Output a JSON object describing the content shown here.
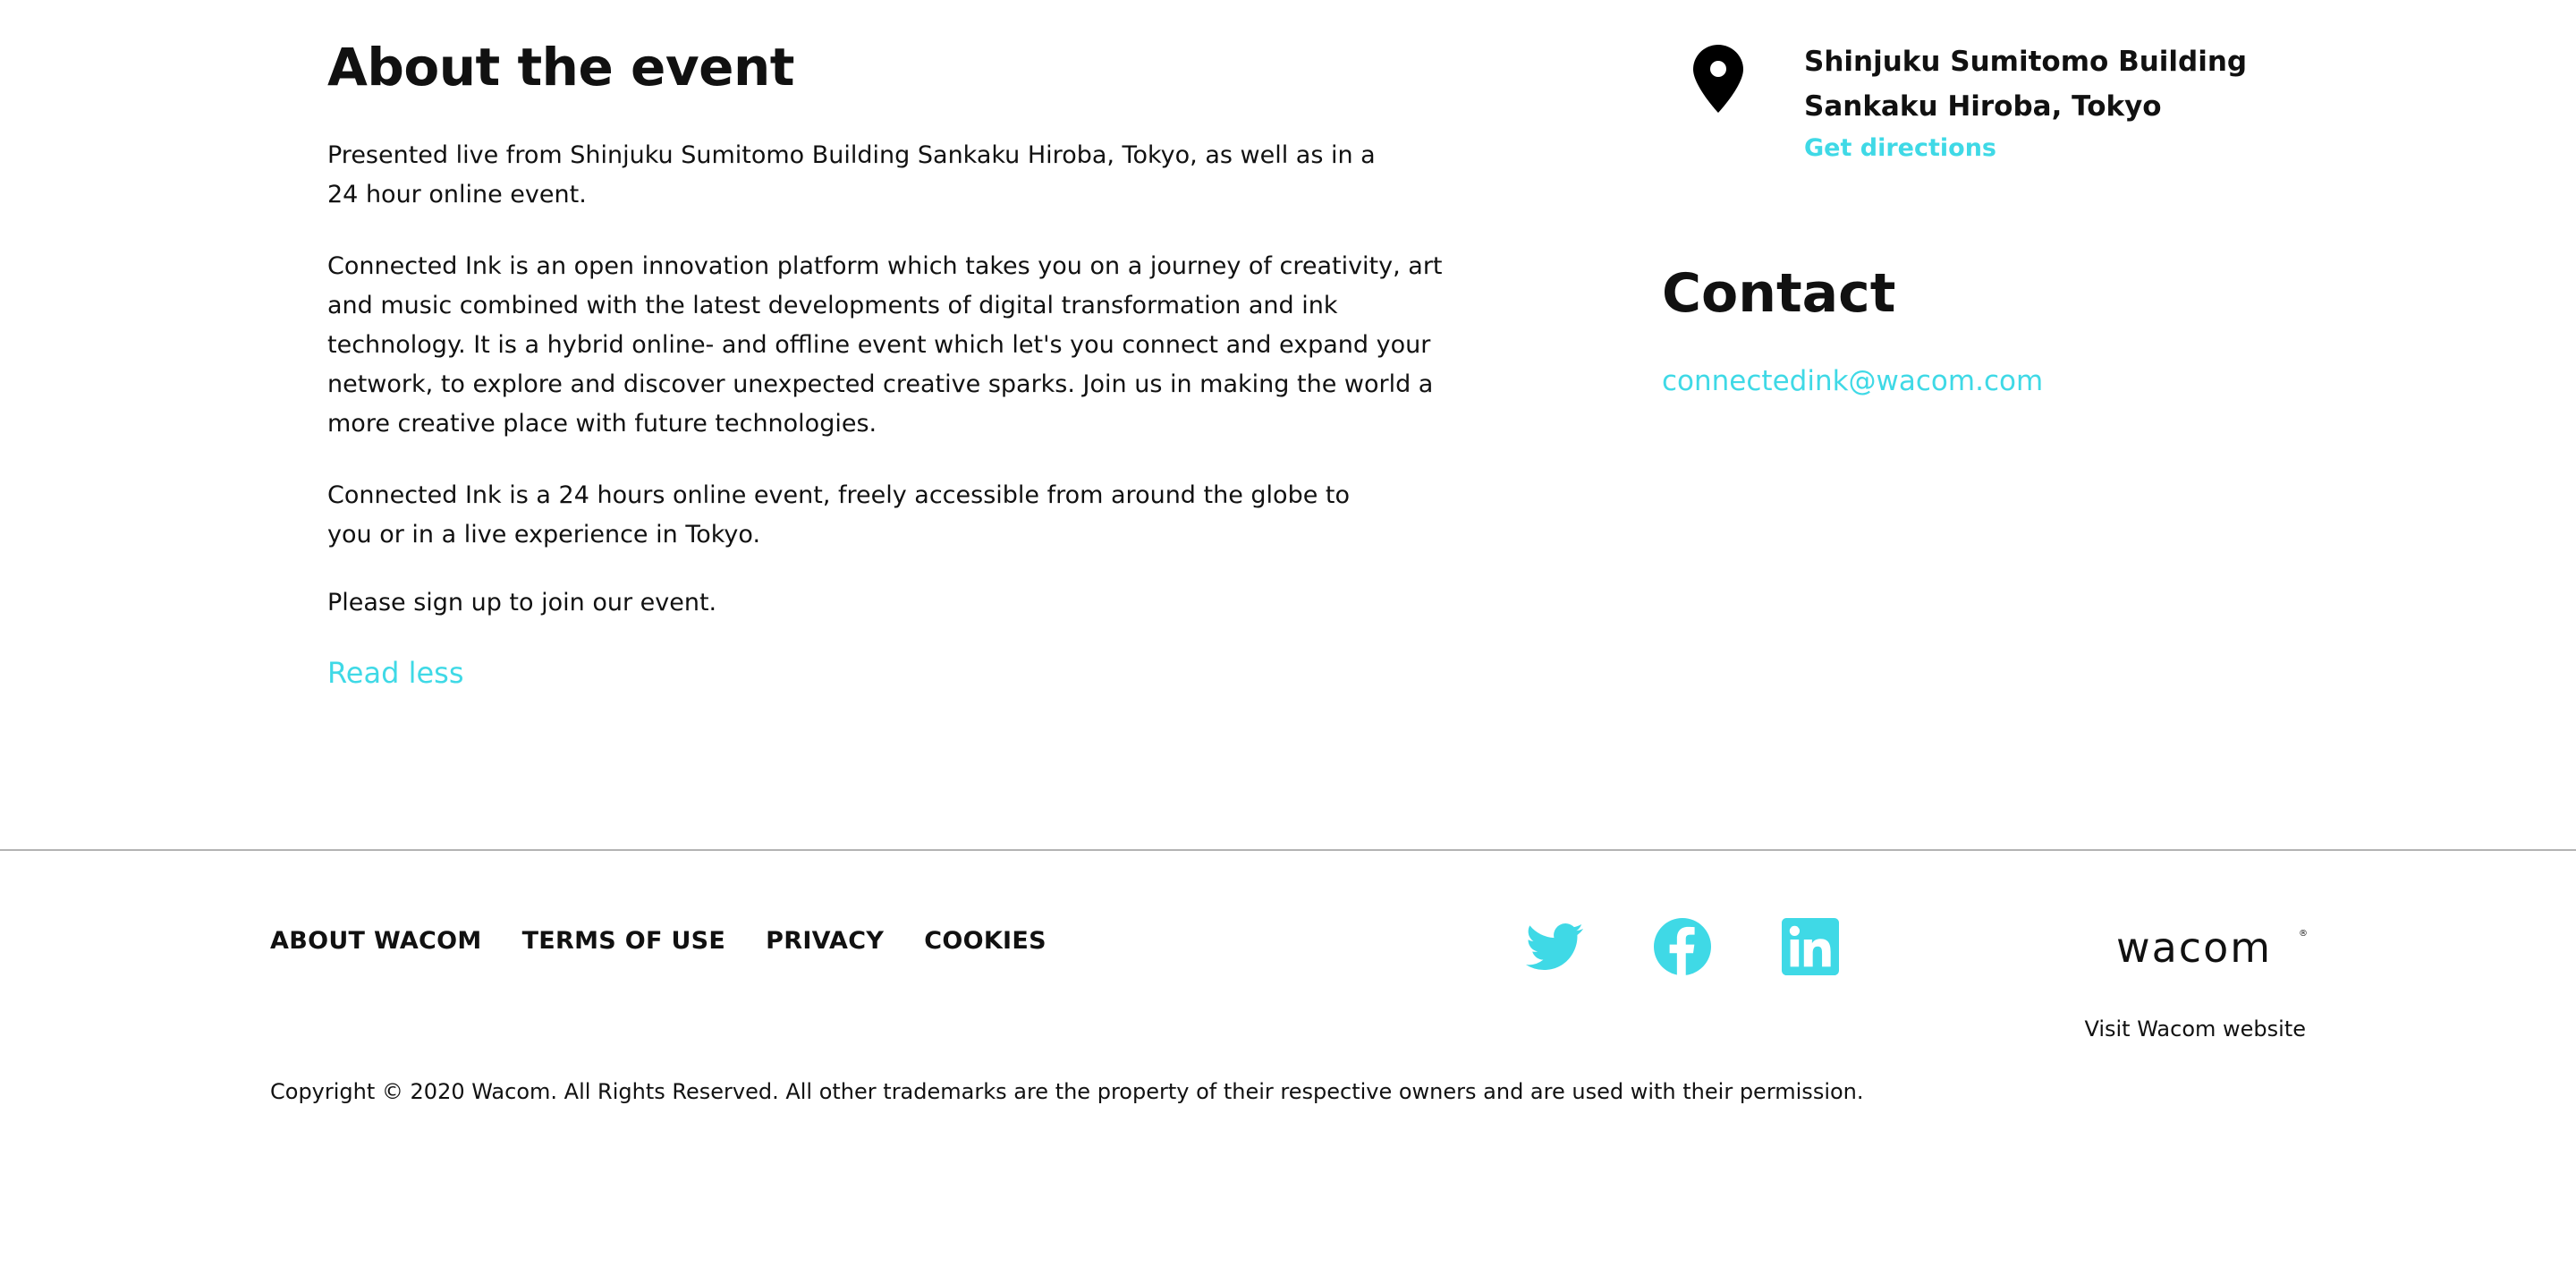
{
  "about": {
    "title": "About the event",
    "paragraphs": [
      "Presented live from Shinjuku Sumitomo Building Sankaku Hiroba, Tokyo, as well as in a 24 hour online event.",
      "Connected Ink is an open innovation platform which takes you on a journey of creativity, art and music combined with the latest developments of digital transformation and ink technology. It is a hybrid online- and offline event which let's you connect and expand your network, to explore and discover unexpected creative sparks. Join us in making the world a more creative place with future technologies.",
      "Connected Ink is a 24 hours online event, freely accessible from around the globe to you or in a live experience in Tokyo.",
      "Please sign up to join our event."
    ],
    "read_less": "Read less"
  },
  "location": {
    "icon": "map-pin-icon",
    "name": "Shinjuku Sumitomo Building Sankaku Hiroba, Tokyo",
    "directions": "Get directions"
  },
  "contact": {
    "title": "Contact",
    "email": "connectedink@wacom.com"
  },
  "footer": {
    "nav": [
      "ABOUT WACOM",
      "TERMS OF USE",
      "PRIVACY",
      "COOKIES"
    ],
    "social": [
      "twitter-icon",
      "facebook-icon",
      "linkedin-icon"
    ],
    "brand": "wacom",
    "brand_reg": "®",
    "visit": "Visit Wacom website",
    "copyright": "Copyright © 2020 Wacom. All Rights Reserved. All other trademarks are the property of their respective owners and are used with their permission."
  },
  "colors": {
    "accent": "#3fd9e6",
    "text": "#111111",
    "divider": "#b3b3b3"
  }
}
